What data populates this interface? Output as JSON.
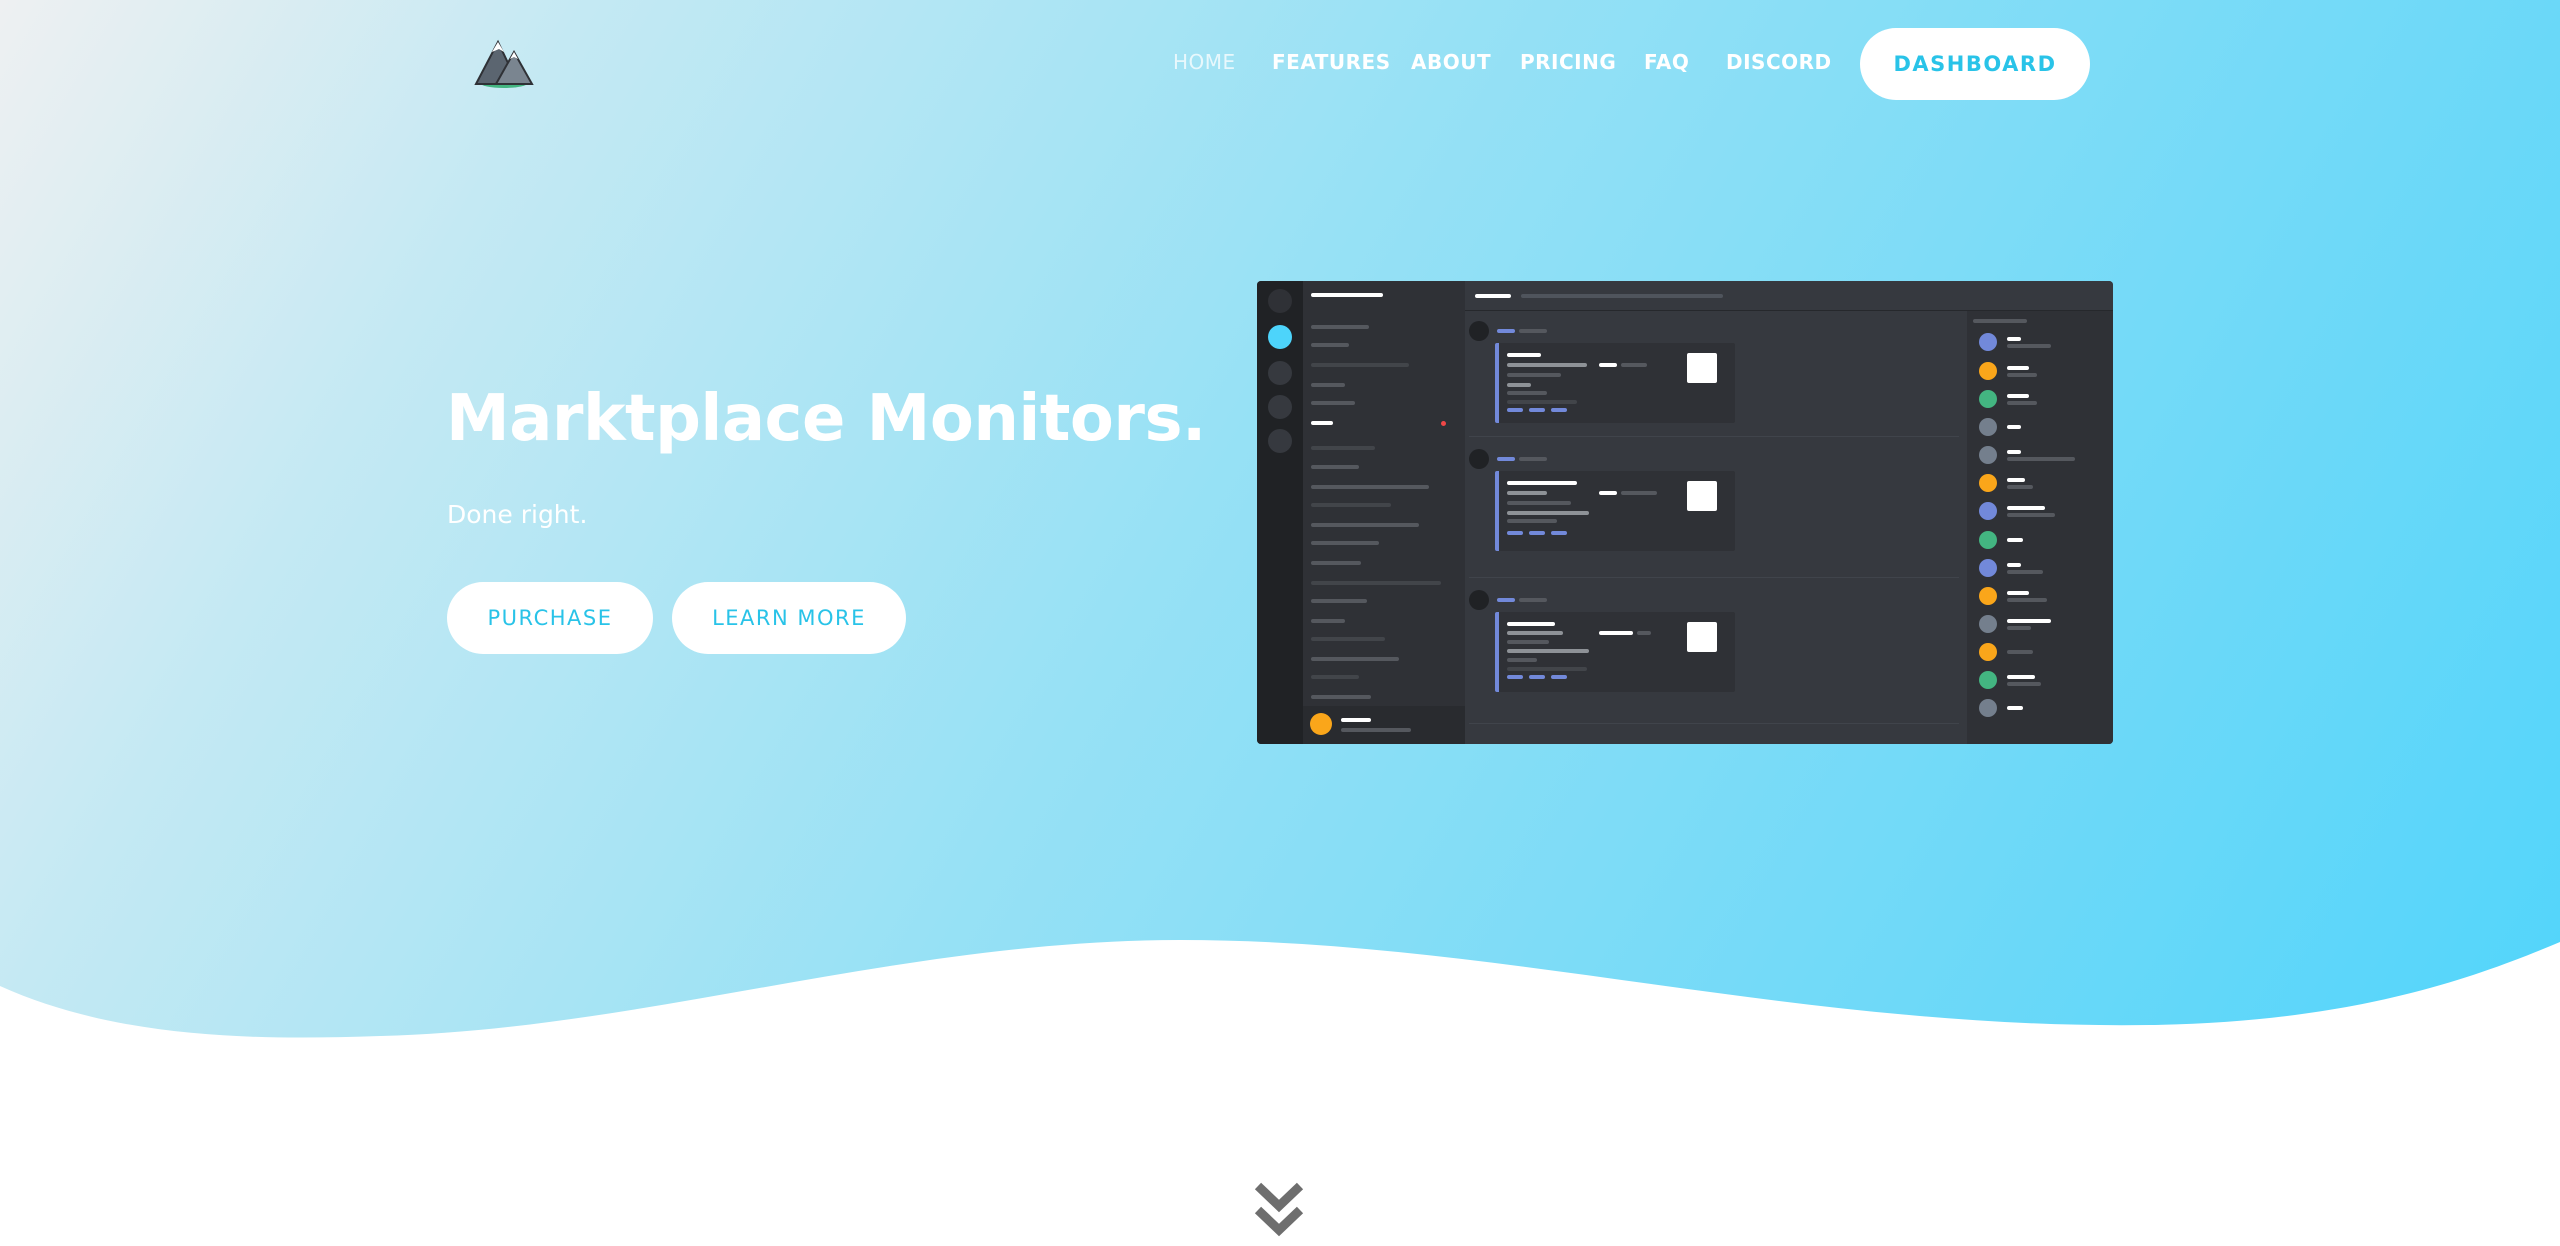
{
  "nav": {
    "links": [
      {
        "label": "HOME",
        "active": true
      },
      {
        "label": "FEATURES",
        "active": false
      },
      {
        "label": "ABOUT",
        "active": false
      },
      {
        "label": "PRICING",
        "active": false
      },
      {
        "label": "FAQ",
        "active": false
      },
      {
        "label": "DISCORD",
        "active": false
      }
    ],
    "dashboard_label": "DASHBOARD"
  },
  "hero": {
    "title": "Marktplace Monitors.",
    "subtitle": "Done right.",
    "purchase_label": "PURCHASE",
    "learn_more_label": "LEARN MORE"
  },
  "colors": {
    "accent": "#29c3e8",
    "gradient_start": "#eef0f2",
    "gradient_end": "#4dd4fb",
    "mock_bg": "#36393f",
    "member_colors": [
      "#7289da",
      "#faa61a",
      "#43b581",
      "#747f8d"
    ]
  },
  "icons": {
    "logo": "mountain-logo-icon",
    "scroll": "double-chevron-down-icon"
  }
}
